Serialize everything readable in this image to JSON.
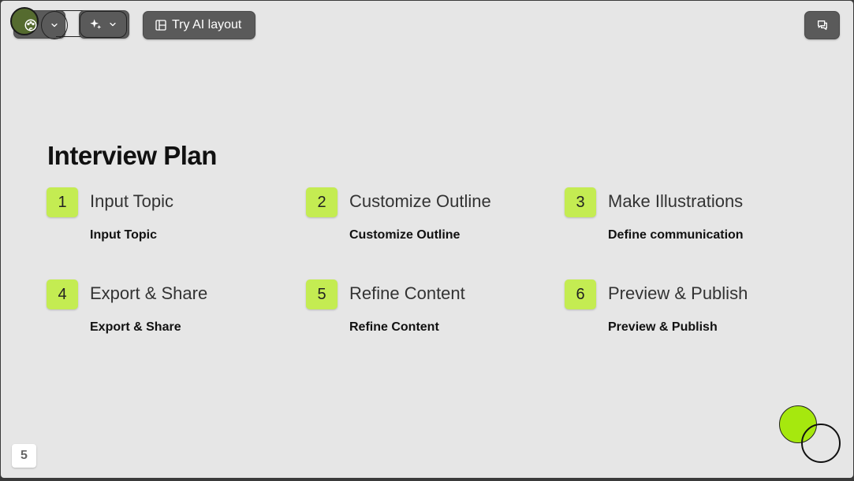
{
  "toolbar": {
    "theme_icon": "palette-icon",
    "theme_dropdown_icon": "chevron-down-icon",
    "ai_icon": "sparkles-icon",
    "ai_dropdown_icon": "chevron-down-icon",
    "try_ai_label": "Try AI layout",
    "try_ai_icon": "layout-icon",
    "comment_icon": "comment-icon"
  },
  "slide": {
    "title": "Interview Plan",
    "steps": [
      {
        "number": "1",
        "heading": "Input Topic",
        "subtitle": "Input Topic"
      },
      {
        "number": "2",
        "heading": "Customize Outline",
        "subtitle": "Customize Outline"
      },
      {
        "number": "3",
        "heading": "Make Illustrations",
        "subtitle": "Define communication"
      },
      {
        "number": "4",
        "heading": "Export & Share",
        "subtitle": "Export & Share"
      },
      {
        "number": "5",
        "heading": "Refine Content",
        "subtitle": "Refine Content"
      },
      {
        "number": "6",
        "heading": "Preview & Publish",
        "subtitle": "Preview & Publish"
      }
    ],
    "page_number": "5"
  },
  "colors": {
    "accent": "#c4ec52",
    "deco_green": "#a6e80e",
    "slide_bg": "#e6e6e6",
    "toolbar_bg": "#5a5a5a"
  }
}
